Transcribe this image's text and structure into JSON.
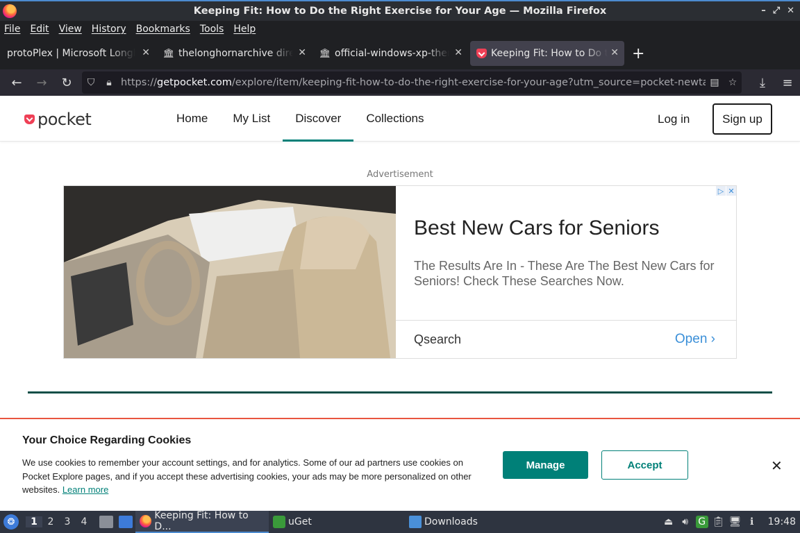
{
  "window": {
    "title": "Keeping Fit: How to Do the Right Exercise for Your Age — Mozilla Firefox",
    "controls": [
      "–",
      "⤢",
      "✕"
    ]
  },
  "menu": [
    "File",
    "Edit",
    "View",
    "History",
    "Bookmarks",
    "Tools",
    "Help"
  ],
  "tabs": [
    {
      "label": "protoPlex | Microsoft Longhorn",
      "icon": "none"
    },
    {
      "label": "thelonghornarchive directory",
      "icon": "archive-icon"
    },
    {
      "label": "official-windows-xp-themes",
      "icon": "archive-icon"
    },
    {
      "label": "Keeping Fit: How to Do the Right Exercise",
      "icon": "pocket-icon",
      "active": true
    }
  ],
  "urlbar": {
    "prefix": "https://",
    "domain": "getpocket.com",
    "path": "/explore/item/keeping-fit-how-to-do-the-right-exercise-for-your-age?utm_source=pocket-newtab"
  },
  "site": {
    "logo": "pocket",
    "nav": [
      "Home",
      "My List",
      "Discover",
      "Collections"
    ],
    "active_nav": "Discover",
    "login": "Log in",
    "signup": "Sign up"
  },
  "ad": {
    "label": "Advertisement",
    "title": "Best New Cars for Seniors",
    "description": "The Results Are In - These Are The Best New Cars for Seniors! Check These Searches Now.",
    "brand": "Qsearch",
    "cta": "Open ›"
  },
  "cookie": {
    "title": "Your Choice Regarding Cookies",
    "text": "We use cookies to remember your account settings, and for analytics. Some of our ad partners use cookies on Pocket Explore pages, and if you accept these advertising cookies, your ads may be more personalized on other websites.",
    "link": "Learn more",
    "manage": "Manage",
    "accept": "Accept",
    "close": "✕"
  },
  "taskbar": {
    "workspaces": [
      "1",
      "2",
      "3",
      "4"
    ],
    "tasks": [
      "Keeping Fit: How to D...",
      "uGet",
      "Downloads"
    ],
    "clock": "19:48"
  },
  "colors": {
    "accent": "#008078",
    "pocket_red": "#ef4056",
    "cookie_border": "#e8553f"
  }
}
